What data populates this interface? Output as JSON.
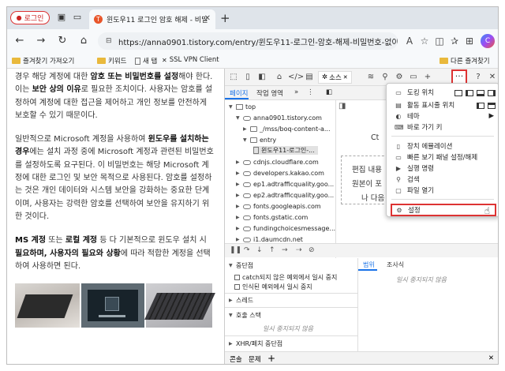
{
  "browser": {
    "profile_label": "로그인",
    "tab_title": "윈도우11 로그인 암호 해제 - 비밀",
    "tab_favicon": "T",
    "address": "https://anna0901.tistory.com/entry/윈도우11-로그인-암호-해제-비밀번호-없이-...",
    "bookmarks": [
      "즐겨찾기 가져오기",
      "키워드",
      "새 탭",
      "SSL VPN Client"
    ],
    "other_bookmarks": "다른 즐겨찾기"
  },
  "article": {
    "p1": [
      {
        "t": "경우 해당 계정에 대한 "
      },
      {
        "t": "암호 또는 비밀번호를 설정",
        "b": true
      },
      {
        "t": "해야 한다. 이는 "
      },
      {
        "t": "보안 상의 이유",
        "b": true
      },
      {
        "t": "로 필요한 조치이다. 사용자는 암호를 설정하여 계정에 대한 접근을 제어하고 개인 정보를 안전하게 보호할 수 있기 때문이다."
      }
    ],
    "p2": [
      {
        "t": "일반적으로 Microsoft 계정을 사용하여 "
      },
      {
        "t": "윈도우를 설치하는 경우",
        "b": true
      },
      {
        "t": "에는 설치 과정 중에 Microsoft 계정과 관련된 비밀번호를 설정하도록 요구된다. 이 비밀번호는 해당 Microsoft 계정에 대한 로그인 및 보안 목적으로 사용된다. 암호를 설정하는 것은 개인 데이터와 시스템 보안을 강화하는 중요한 단계이며, 사용자는 강력한 암호를 선택하여 보안을 유지하기 위한 것이다."
      }
    ],
    "p3": [
      {
        "t": "MS 계정",
        "b": true
      },
      {
        "t": " 또는 "
      },
      {
        "t": "로컬 계정",
        "b": true
      },
      {
        "t": " 등 다 기본적으로 윈도우 설치 시 "
      },
      {
        "t": "필요하며, 사용자의 필요와 상황",
        "b": true
      },
      {
        "t": "에 따라 적합한 계정을 선택하여 사용하면 된다."
      }
    ]
  },
  "devtools": {
    "sources_label": "소스",
    "subtabs": [
      "페이지",
      "작업 영역"
    ],
    "tree": {
      "top": "top",
      "site": "anna0901.tistory.com",
      "folder1": "_/mss/boq-content-a...",
      "entry": "entry",
      "file": "윈도우11-로그인-...",
      "domains": [
        "cdnjs.cloudflare.com",
        "developers.kakao.com",
        "ep1.adtrafficquality.goo...",
        "ep2.adtrafficquality.goo...",
        "fonts.googleapis.com",
        "fonts.gstatic.com",
        "fundingchoicesmessage...",
        "i1.daumcdn.net"
      ]
    },
    "editor_lines": [
      "Ct",
      "편집 내용",
      "원본이 포",
      "나 다음"
    ],
    "sections": {
      "breakpoints": "중단점",
      "pause_uncaught": "catch되지 않은 예외에서 일시 중지",
      "pause_caught": "인식된 예외에서 일시 중지",
      "scope": "스레드",
      "callstack": "호출 스택",
      "not_paused": "일시 중지되지 않음",
      "xhr": "XHR/페치 중단점"
    },
    "right_tabs": [
      "범위",
      "조사식"
    ],
    "right_not_paused": "일시 중지되지 않음",
    "drawer_tabs": [
      "콘솔",
      "문제"
    ]
  },
  "menu": {
    "dock_label": "도킹 위치",
    "items": [
      "활동 표시줄 위치",
      "테마",
      "바로 가기 키",
      "장치 에뮬레이션",
      "빠른 보기 패널 설정/해제",
      "실행 명령",
      "검색",
      "파일 열기"
    ],
    "settings": "설정"
  },
  "colors": {
    "highlight": "#dd3333",
    "accent": "#1a73e8"
  }
}
